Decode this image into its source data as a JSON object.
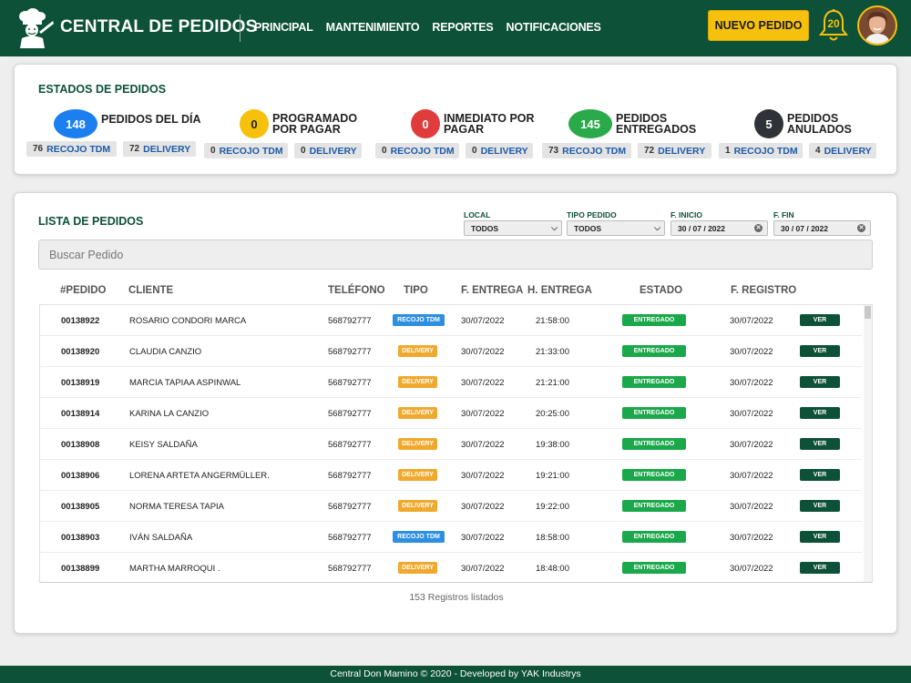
{
  "header": {
    "title": "CENTRAL DE PEDIDOS",
    "nav": [
      "PRINCIPAL",
      "MANTENIMIENTO",
      "REPORTES",
      "NOTIFICACIONES"
    ],
    "new_order_label": "NUEVO PEDIDO",
    "notification_count": "20",
    "colors": {
      "brand": "#0d5138",
      "accent": "#f6c10d"
    }
  },
  "status": {
    "title": "ESTADOS DE PEDIDOS",
    "groups": [
      {
        "count": "148",
        "label1": "PEDIDOS DEL DÍA",
        "label2": "",
        "color": "#1b7ff0",
        "recojo_count": "76",
        "recojo_label": "RECOJO TDM",
        "delivery_count": "72",
        "delivery_label": "DELIVERY"
      },
      {
        "count": "0",
        "label1": "PROGRAMADO",
        "label2": "POR PAGAR",
        "color": "#f6c10d",
        "recojo_count": "0",
        "recojo_label": "RECOJO TDM",
        "delivery_count": "0",
        "delivery_label": "DELIVERY"
      },
      {
        "count": "0",
        "label1": "INMEDIATO POR",
        "label2": "PAGAR",
        "color": "#e03c3c",
        "recojo_count": "0",
        "recojo_label": "RECOJO TDM",
        "delivery_count": "0",
        "delivery_label": "DELIVERY"
      },
      {
        "count": "145",
        "label1": "PEDIDOS",
        "label2": "ENTREGADOS",
        "color": "#2aaa4a",
        "recojo_count": "73",
        "recojo_label": "RECOJO TDM",
        "delivery_count": "72",
        "delivery_label": "DELIVERY"
      },
      {
        "count": "5",
        "label1": "PEDIDOS",
        "label2": "ANULADOS",
        "color": "#2f3338",
        "recojo_count": "1",
        "recojo_label": "RECOJO TDM",
        "delivery_count": "4",
        "delivery_label": "DELIVERY"
      }
    ]
  },
  "list": {
    "title": "LISTA DE PEDIDOS",
    "filters": {
      "local_label": "LOCAL",
      "local_value": "TODOS",
      "tipo_label": "TIPO PEDIDO",
      "tipo_value": "TODOS",
      "inicio_label": "F. INICIO",
      "inicio_value": "30 / 07 / 2022",
      "fin_label": "F. FIN",
      "fin_value": "30 / 07 / 2022"
    },
    "search_placeholder": "Buscar Pedido",
    "columns": [
      "#PEDIDO",
      "CLIENTE",
      "TELÉFONO",
      "TIPO",
      "F. ENTREGA",
      "H. ENTREGA",
      "ESTADO",
      "F. REGISTRO"
    ],
    "rows": [
      {
        "id": "00138922",
        "cliente": "ROSARIO CONDORI MARCA",
        "telefono": "568792777",
        "tipo": "RECOJO TDM",
        "f_entrega": "30/07/2022",
        "h_entrega": "21:58:00",
        "estado": "ENTREGADO",
        "f_registro": "30/07/2022",
        "action": "VER"
      },
      {
        "id": "00138920",
        "cliente": "CLAUDIA CANZIO",
        "telefono": "568792777",
        "tipo": "DELIVERY",
        "f_entrega": "30/07/2022",
        "h_entrega": "21:33:00",
        "estado": "ENTREGADO",
        "f_registro": "30/07/2022",
        "action": "VER"
      },
      {
        "id": "00138919",
        "cliente": "MARCIA TAPIAA ASPINWAL",
        "telefono": "568792777",
        "tipo": "DELIVERY",
        "f_entrega": "30/07/2022",
        "h_entrega": "21:21:00",
        "estado": "ENTREGADO",
        "f_registro": "30/07/2022",
        "action": "VER"
      },
      {
        "id": "00138914",
        "cliente": "KARINA LA CANZIO",
        "telefono": "568792777",
        "tipo": "DELIVERY",
        "f_entrega": "30/07/2022",
        "h_entrega": "20:25:00",
        "estado": "ENTREGADO",
        "f_registro": "30/07/2022",
        "action": "VER"
      },
      {
        "id": "00138908",
        "cliente": "KEISY SALDAÑA",
        "telefono": "568792777",
        "tipo": "DELIVERY",
        "f_entrega": "30/07/2022",
        "h_entrega": "19:38:00",
        "estado": "ENTREGADO",
        "f_registro": "30/07/2022",
        "action": "VER"
      },
      {
        "id": "00138906",
        "cliente": "LORENA ARTETA ANGERMÜLLER.",
        "telefono": "568792777",
        "tipo": "DELIVERY",
        "f_entrega": "30/07/2022",
        "h_entrega": "19:21:00",
        "estado": "ENTREGADO",
        "f_registro": "30/07/2022",
        "action": "VER"
      },
      {
        "id": "00138905",
        "cliente": "NORMA TERESA TAPIA",
        "telefono": "568792777",
        "tipo": "DELIVERY",
        "f_entrega": "30/07/2022",
        "h_entrega": "19:22:00",
        "estado": "ENTREGADO",
        "f_registro": "30/07/2022",
        "action": "VER"
      },
      {
        "id": "00138903",
        "cliente": "IVÁN SALDAÑA",
        "telefono": "568792777",
        "tipo": "RECOJO TDM",
        "f_entrega": "30/07/2022",
        "h_entrega": "18:58:00",
        "estado": "ENTREGADO",
        "f_registro": "30/07/2022",
        "action": "VER"
      },
      {
        "id": "00138899",
        "cliente": "MARTHA MARROQUI .",
        "telefono": "568792777",
        "tipo": "DELIVERY",
        "f_entrega": "30/07/2022",
        "h_entrega": "18:48:00",
        "estado": "ENTREGADO",
        "f_registro": "30/07/2022",
        "action": "VER"
      }
    ],
    "tipo_colors": {
      "RECOJO TDM": "#2d8fe0",
      "DELIVERY": "#f0a92f"
    },
    "estado_color": "#1aa84a",
    "records_text": "153 Registros listados"
  },
  "footer": {
    "text": "Central Don Mamino © 2020 - Developed by YAK Industrys"
  }
}
